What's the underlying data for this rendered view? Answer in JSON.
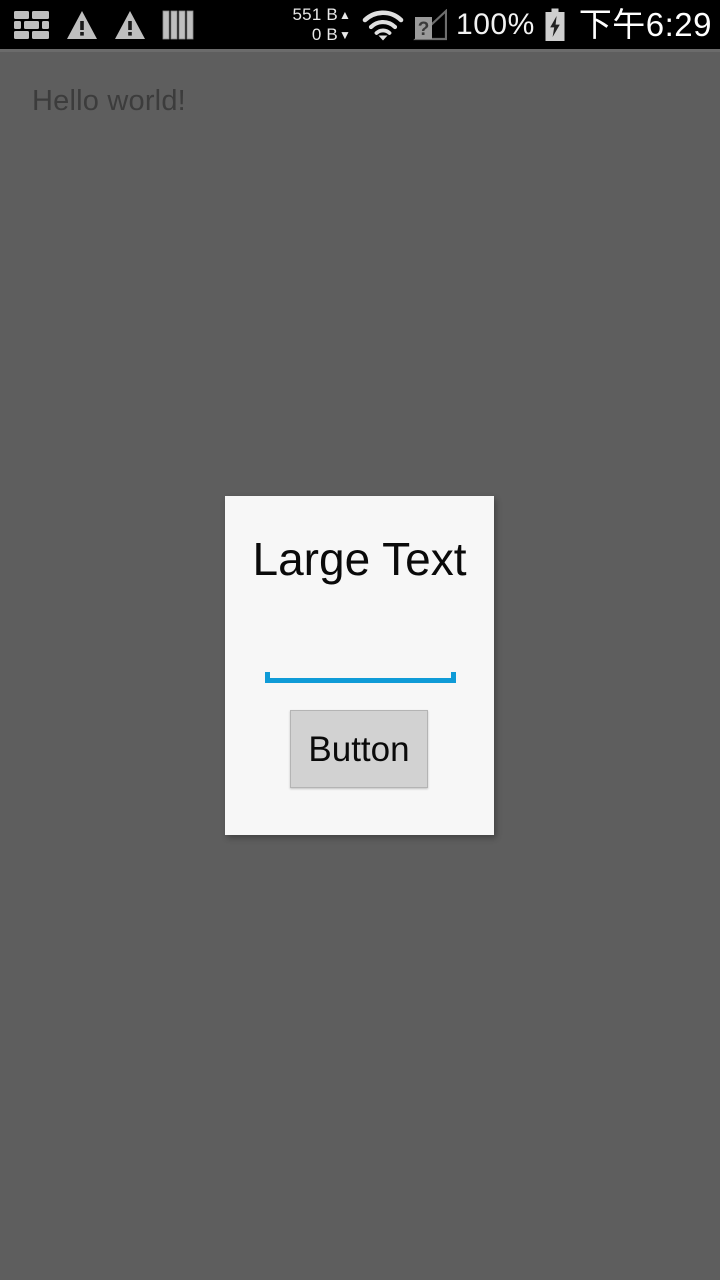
{
  "status_bar": {
    "background_color": "#000000",
    "left_icons": [
      {
        "name": "brick-wall-icon",
        "label": "firewall"
      },
      {
        "name": "warning-triangle-icon-1",
        "label": "warning"
      },
      {
        "name": "warning-triangle-icon-2",
        "label": "warning"
      },
      {
        "name": "vertical-bars-icon",
        "label": "bars"
      }
    ],
    "traffic": {
      "upload_value": "551 B",
      "upload_arrow": "▲",
      "download_value": "0 B",
      "download_arrow": "▼"
    },
    "wifi_icon": "wifi-icon",
    "signal_icon": "mobile-signal-unknown-icon",
    "signal_badge": "?",
    "battery_percent": "100%",
    "battery_icon": "battery-charging-icon",
    "clock": "下午6:29"
  },
  "app": {
    "background_color": "#5e5e5e",
    "hello_text": "Hello world!"
  },
  "dialog": {
    "background_color": "#f7f7f7",
    "title": "Large Text",
    "input": {
      "value": "",
      "placeholder": "",
      "underline_color": "#0f9bd7"
    },
    "button_label": "Button"
  }
}
